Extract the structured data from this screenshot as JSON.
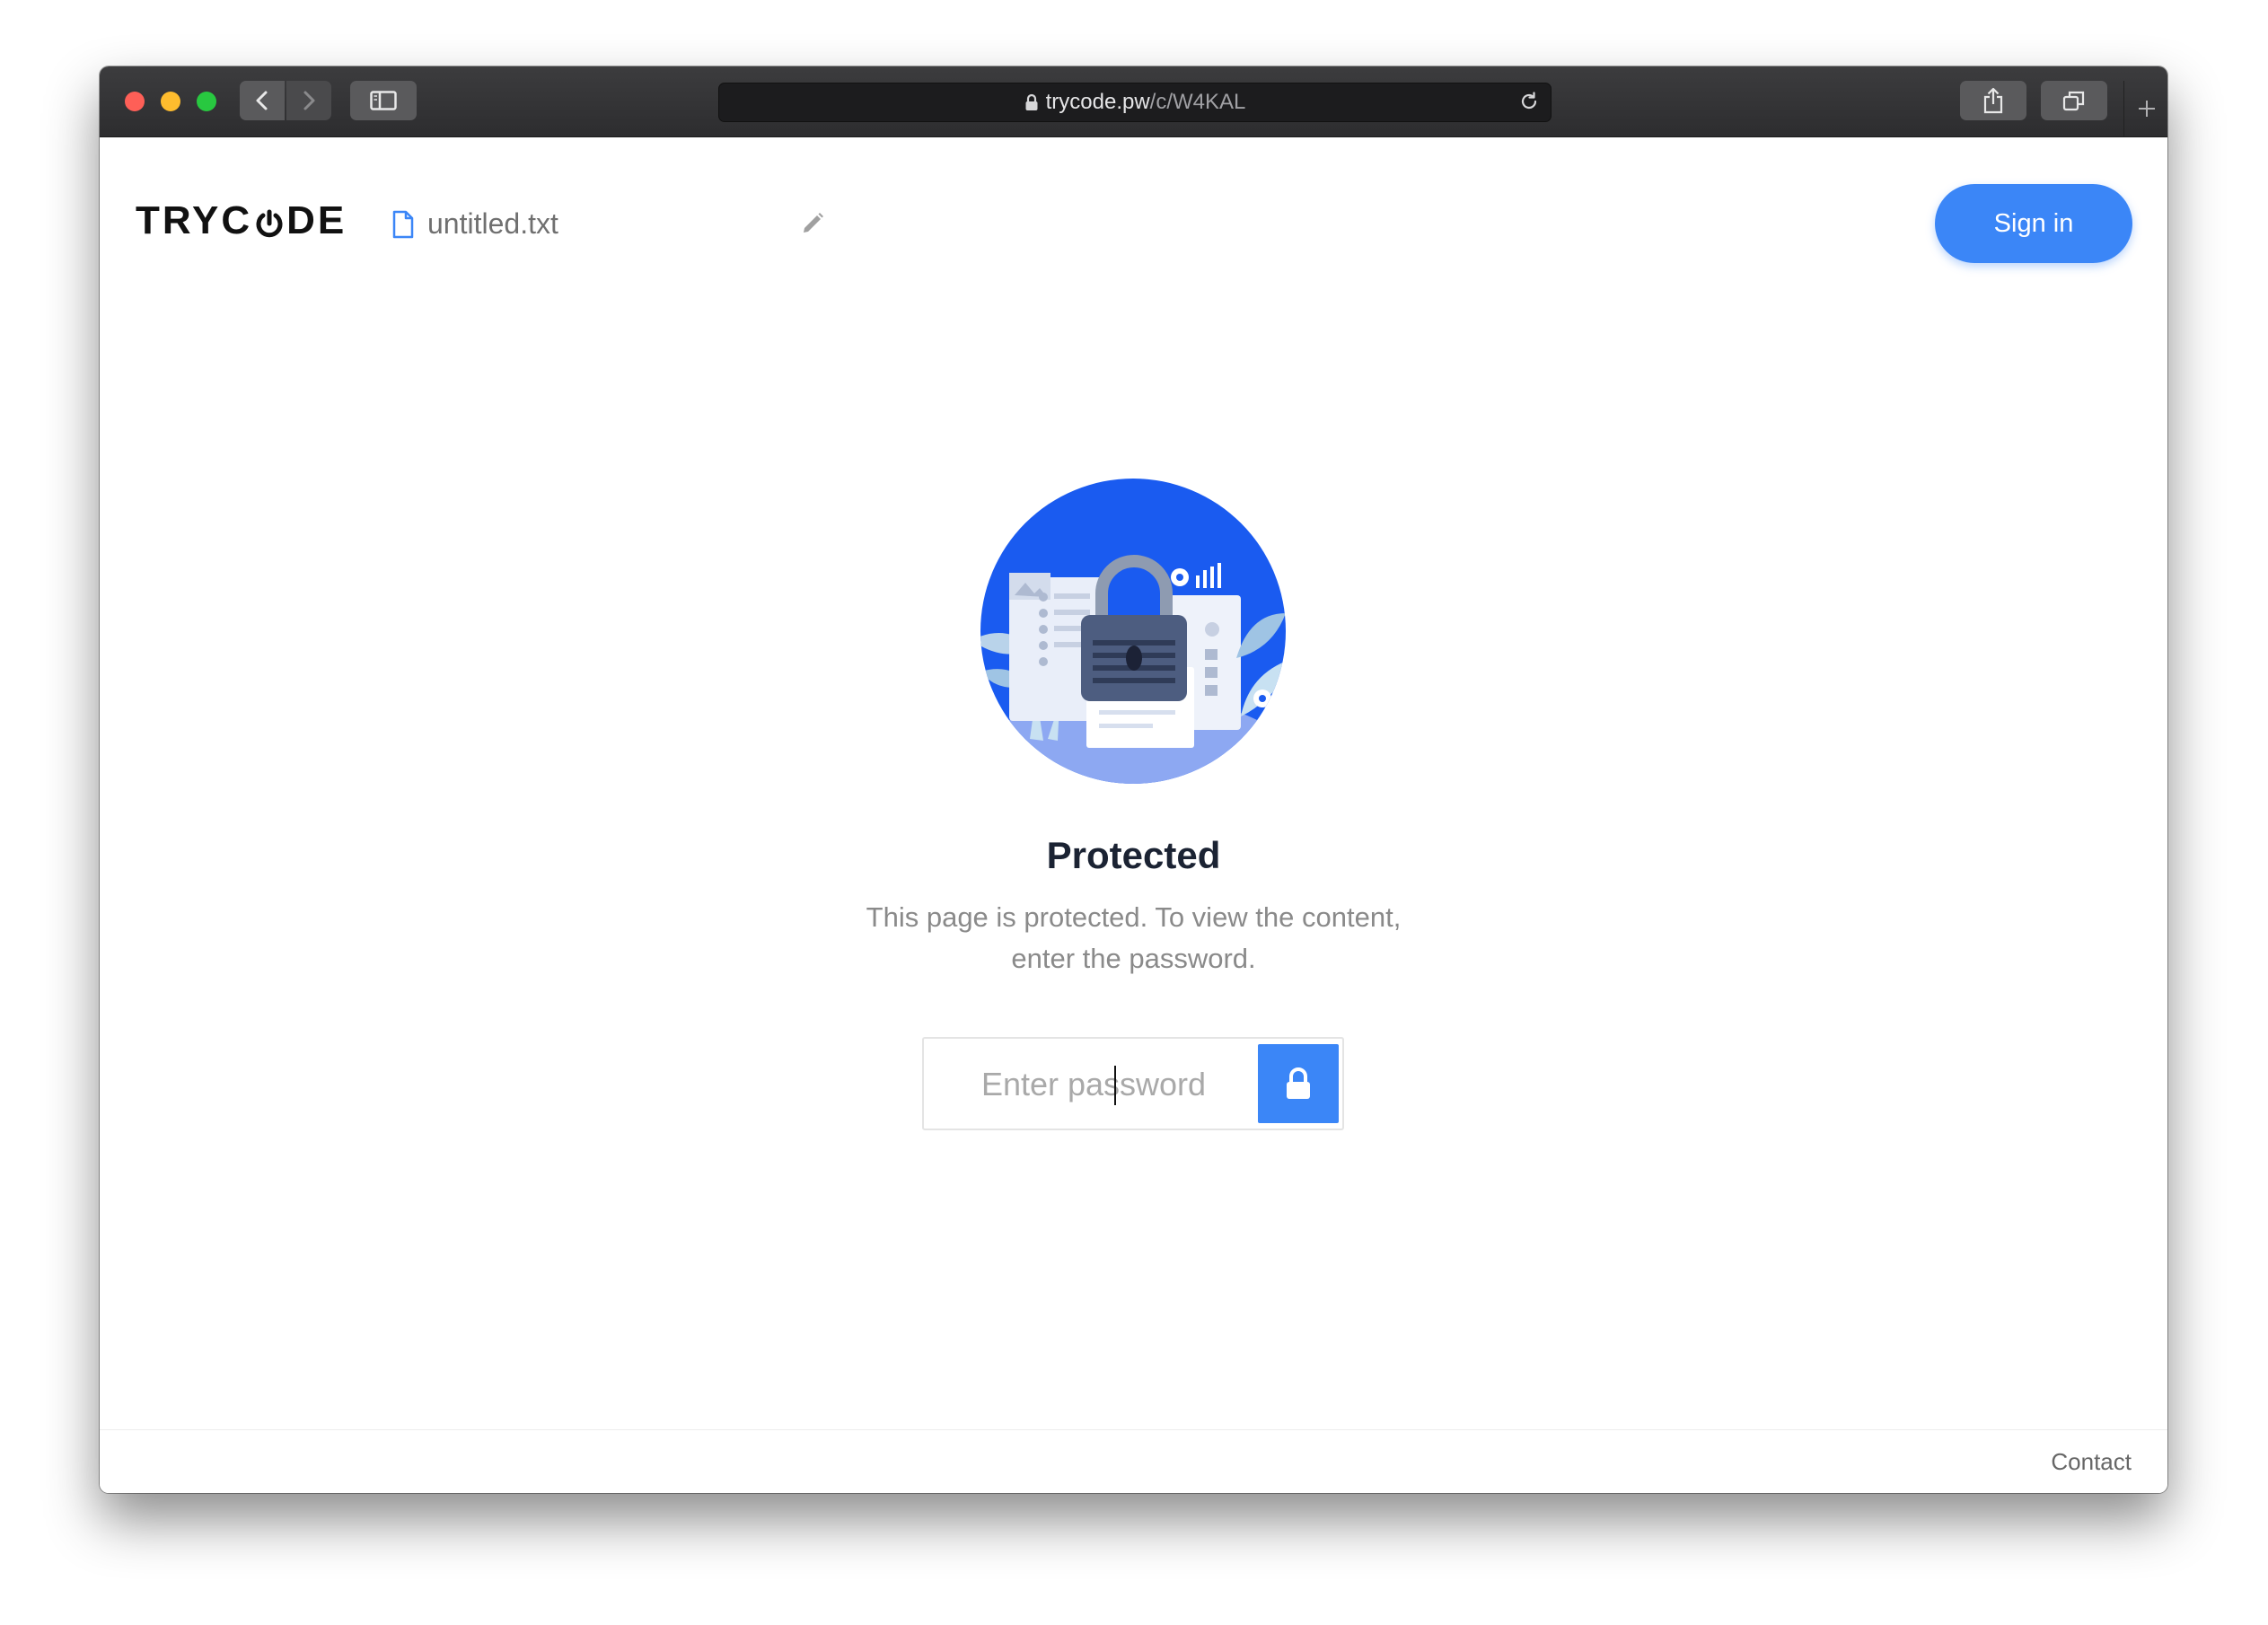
{
  "browser": {
    "url_host": "trycode.pw",
    "url_path": "/c/W4KAL"
  },
  "header": {
    "logo_text_left": "TRYC",
    "logo_text_right": "DE",
    "file_name": "untitled.txt",
    "signin_label": "Sign in"
  },
  "main": {
    "title": "Protected",
    "description_line1": "This page is protected. To view the content,",
    "description_line2": "enter the password.",
    "password_placeholder": "Enter password"
  },
  "footer": {
    "contact_label": "Contact"
  },
  "colors": {
    "accent": "#3b86f7",
    "hero_blue": "#1a5bf0",
    "title": "#1b2333"
  },
  "icons": [
    "back-chevron-icon",
    "forward-chevron-icon",
    "sidebar-icon",
    "lock-icon",
    "reload-icon",
    "share-icon",
    "tabs-icon",
    "plus-icon",
    "file-icon",
    "pencil-icon",
    "padlock-icon"
  ]
}
